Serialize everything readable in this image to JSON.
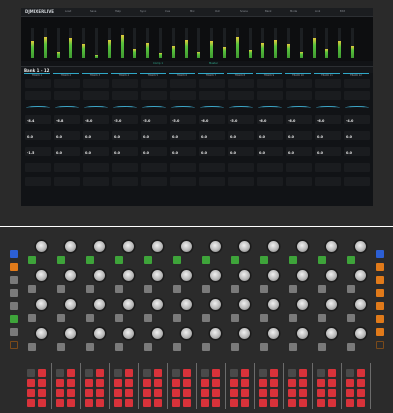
{
  "app": {
    "title": "DJMIXERLIVE"
  },
  "menu": [
    "Load",
    "Save",
    "Help",
    "Sync",
    "Cue",
    "Mix",
    "Out",
    "Scene",
    "Bank",
    "Mode",
    "Link",
    "Edit"
  ],
  "bank": {
    "label": "Bank 1 - 12"
  },
  "status": {
    "left": "Comp 1",
    "right": "Master"
  },
  "tracks": [
    {
      "name": "TRACK 1",
      "v1": "-8.4",
      "v2": "0.0",
      "v3": "-1.5"
    },
    {
      "name": "TRACK 2",
      "v1": "-6.8",
      "v2": "0.0",
      "v3": "0.0"
    },
    {
      "name": "TRACK 3",
      "v1": "-8.0",
      "v2": "0.0",
      "v3": "0.0"
    },
    {
      "name": "TRACK 4",
      "v1": "-5.0",
      "v2": "0.0",
      "v3": "0.0"
    },
    {
      "name": "TRACK 5",
      "v1": "-5.0",
      "v2": "0.0",
      "v3": "0.0"
    },
    {
      "name": "TRACK 6",
      "v1": "-5.0",
      "v2": "0.0",
      "v3": "0.0"
    },
    {
      "name": "TRACK 7",
      "v1": "-6.0",
      "v2": "0.0",
      "v3": "0.0"
    },
    {
      "name": "TRACK 8",
      "v1": "-5.0",
      "v2": "0.0",
      "v3": "0.0"
    },
    {
      "name": "TRACK 9",
      "v1": "-6.0",
      "v2": "0.0",
      "v3": "0.0"
    },
    {
      "name": "TRACK 10",
      "v1": "-6.0",
      "v2": "0.0",
      "v3": "0.0"
    },
    {
      "name": "TRACK 11",
      "v1": "-6.0",
      "v2": "0.0",
      "v3": "0.0"
    },
    {
      "name": "TRACK 12",
      "v1": "-4.0",
      "v2": "0.0",
      "v3": "0.0"
    }
  ],
  "meter_levels": [
    0.55,
    0.7,
    0.2,
    0.65,
    0.45,
    0.1,
    0.6,
    0.75,
    0.3,
    0.5,
    0.15,
    0.4,
    0.6,
    0.2,
    0.55,
    0.35,
    0.7,
    0.25,
    0.5,
    0.6,
    0.45,
    0.2,
    0.65,
    0.3,
    0.55,
    0.4
  ],
  "colors": {
    "accent": "#3da7c9",
    "green": "#3ea43a",
    "red": "#d8323a",
    "orange": "#e07a1a",
    "blue": "#2c5fd4"
  },
  "side_buttons_left": [
    "blue",
    "orange",
    "gray",
    "gray",
    "gray",
    "green",
    "gray",
    "brown"
  ],
  "side_buttons_right": [
    "blue",
    "orange",
    "orange",
    "orange",
    "orange",
    "orange",
    "orange",
    "brown"
  ]
}
